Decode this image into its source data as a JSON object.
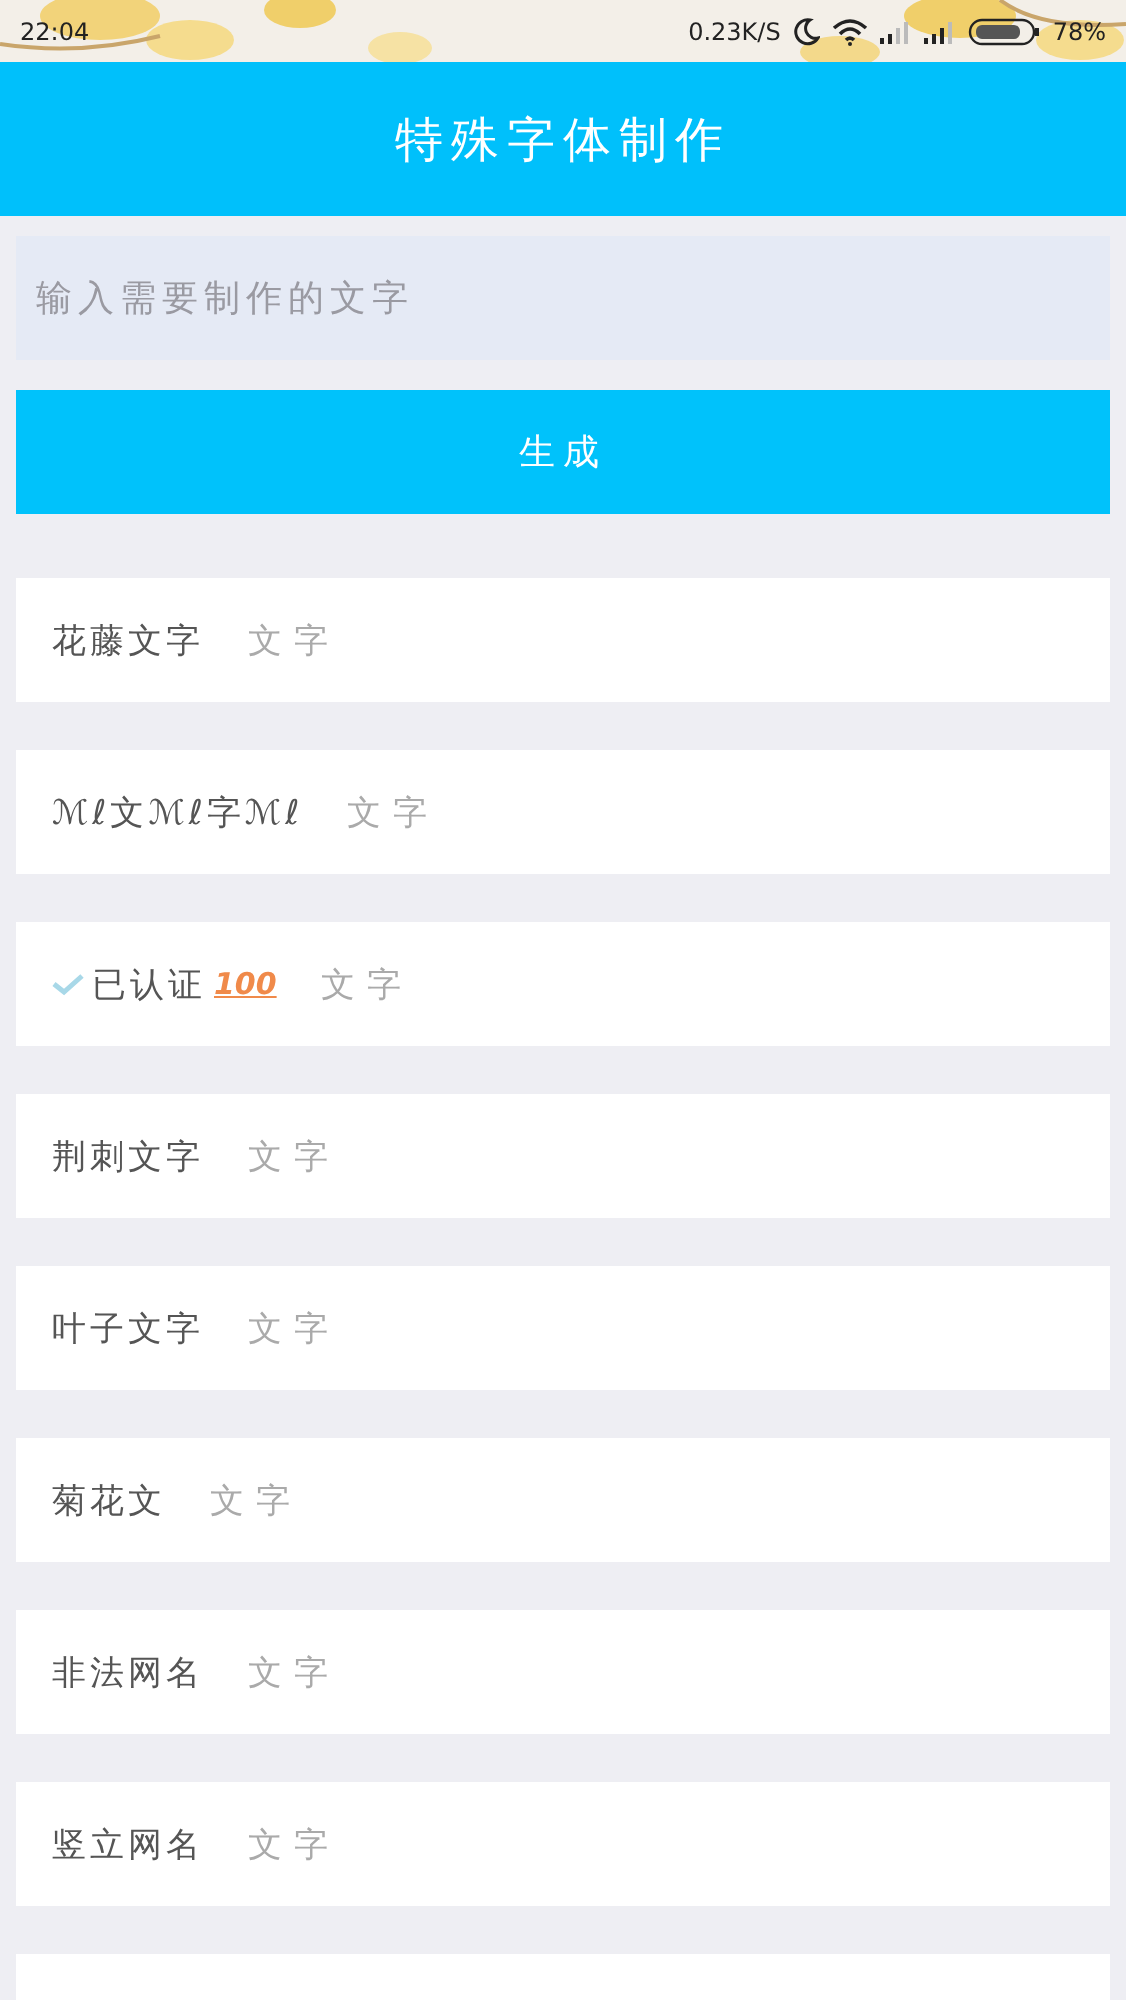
{
  "status_bar": {
    "time": "22:04",
    "speed": "0.23K/S",
    "battery": "78%"
  },
  "header": {
    "title": "特殊字体制作"
  },
  "input": {
    "placeholder": "输入需要制作的文字"
  },
  "generate_button": {
    "label": "生成"
  },
  "styles": [
    {
      "kind": "plain",
      "label": "花藤文字",
      "sample": "文字"
    },
    {
      "kind": "plain",
      "label": "ℳℓ文ℳℓ字ℳℓ",
      "sample": "文字"
    },
    {
      "kind": "verified",
      "label": "已认证",
      "badge": "100",
      "sample": "文字"
    },
    {
      "kind": "plain",
      "label": "荆刺文字",
      "sample": "文字"
    },
    {
      "kind": "plain",
      "label": "叶子文字",
      "sample": "文字"
    },
    {
      "kind": "plain",
      "label": "菊花文",
      "sample": "文字"
    },
    {
      "kind": "plain",
      "label": "非法网名",
      "sample": "文字"
    },
    {
      "kind": "plain",
      "label": "竖立网名",
      "sample": "文字"
    },
    {
      "kind": "blank"
    }
  ]
}
